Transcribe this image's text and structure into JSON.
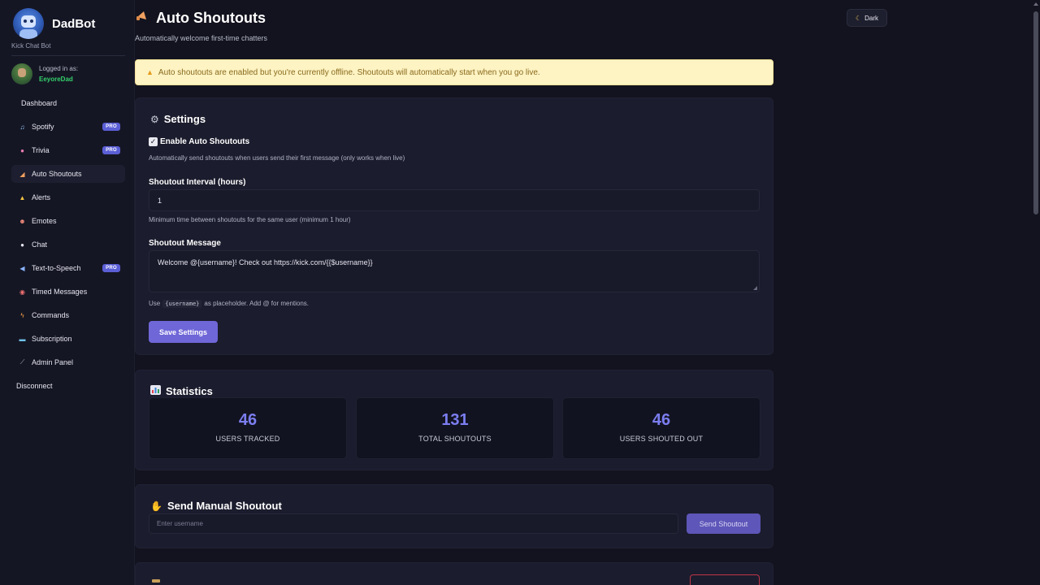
{
  "brand": {
    "name": "DadBot",
    "subtitle": "Kick Chat Bot"
  },
  "user": {
    "label": "Logged in as:",
    "name": "EeyoreDad"
  },
  "nav": {
    "items": [
      {
        "label": "Dashboard",
        "icon": "none",
        "pro": false
      },
      {
        "label": "Spotify",
        "icon": "music-icon",
        "pro": true
      },
      {
        "label": "Trivia",
        "icon": "brain-icon",
        "pro": true
      },
      {
        "label": "Auto Shoutouts",
        "icon": "megaphone-icon",
        "pro": false,
        "active": true
      },
      {
        "label": "Alerts",
        "icon": "bell-icon",
        "pro": false
      },
      {
        "label": "Emotes",
        "icon": "smile-icon",
        "pro": false
      },
      {
        "label": "Chat",
        "icon": "speech-bubble-icon",
        "pro": false
      },
      {
        "label": "Text-to-Speech",
        "icon": "speaker-icon",
        "pro": true
      },
      {
        "label": "Timed Messages",
        "icon": "alarm-clock-icon",
        "pro": false
      },
      {
        "label": "Commands",
        "icon": "lightning-icon",
        "pro": false
      },
      {
        "label": "Subscription",
        "icon": "credit-card-icon",
        "pro": false
      },
      {
        "label": "Admin Panel",
        "icon": "wrench-icon",
        "pro": false
      }
    ],
    "pro_label": "PRO",
    "disconnect": "Disconnect"
  },
  "header": {
    "title": "Auto Shoutouts",
    "subtitle": "Automatically welcome first-time chatters",
    "theme_toggle": "Dark"
  },
  "alert": {
    "text": "Auto shoutouts are enabled but you're currently offline. Shoutouts will automatically start when you go live."
  },
  "settings": {
    "title": "Settings",
    "enable_label": "Enable Auto Shoutouts",
    "enable_checked": true,
    "enable_help": "Automatically send shoutouts when users send their first message (only works when live)",
    "interval_label": "Shoutout Interval (hours)",
    "interval_value": "1",
    "interval_help": "Minimum time between shoutouts for the same user (minimum 1 hour)",
    "message_label": "Shoutout Message",
    "message_value": "Welcome @{username}! Check out https://kick.com/{{$username}}",
    "placeholder_help_pre": "Use",
    "placeholder_code": "{username}",
    "placeholder_help_post": "as placeholder. Add @ for mentions.",
    "save_button": "Save Settings"
  },
  "statistics": {
    "title": "Statistics",
    "items": [
      {
        "value": "46",
        "label": "USERS TRACKED"
      },
      {
        "value": "131",
        "label": "TOTAL SHOUTOUTS"
      },
      {
        "value": "46",
        "label": "USERS SHOUTED OUT"
      }
    ]
  },
  "manual": {
    "title": "Send Manual Shoutout",
    "input_placeholder": "Enter username",
    "send_button": "Send Shoutout"
  },
  "colors": {
    "accent": "#6f66d8",
    "stat_value": "#7b7ef0",
    "username": "#34d06a",
    "alert_bg": "#fdf3c3"
  }
}
